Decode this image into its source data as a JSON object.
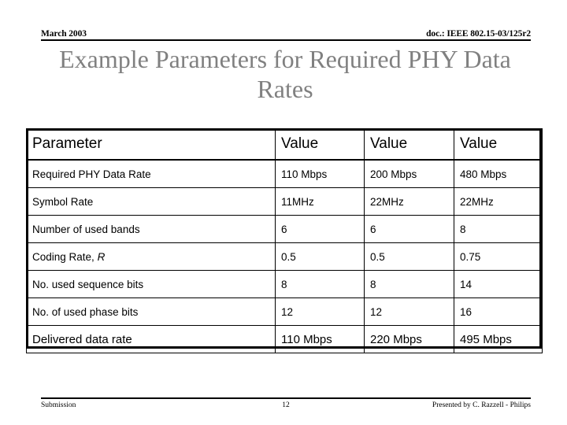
{
  "header": {
    "left": "March 2003",
    "right": "doc.: IEEE 802.15-03/125r2"
  },
  "title": "Example Parameters for Required PHY Data Rates",
  "table": {
    "columns": [
      "Parameter",
      "Value",
      "Value",
      "Value"
    ],
    "rows": [
      {
        "label": "Required PHY Data Rate",
        "label_italic_suffix": "",
        "values": [
          "110 Mbps",
          "200 Mbps",
          "480 Mbps"
        ]
      },
      {
        "label": "Symbol Rate",
        "label_italic_suffix": "",
        "values": [
          "11MHz",
          "22MHz",
          "22MHz"
        ]
      },
      {
        "label": "Number of used bands",
        "label_italic_suffix": "",
        "values": [
          "6",
          "6",
          "8"
        ]
      },
      {
        "label": "Coding Rate, ",
        "label_italic_suffix": "R",
        "values": [
          "0.5",
          "0.5",
          "0.75"
        ]
      },
      {
        "label": "No. used sequence bits",
        "label_italic_suffix": "",
        "values": [
          "8",
          "8",
          "14"
        ]
      },
      {
        "label": "No. of used phase bits",
        "label_italic_suffix": "",
        "values": [
          "12",
          "12",
          "16"
        ]
      },
      {
        "label": "Delivered data rate",
        "label_italic_suffix": "",
        "values": [
          "110 Mbps",
          "220 Mbps",
          "495 Mbps"
        ]
      }
    ]
  },
  "footer": {
    "left": "Submission",
    "page": "12",
    "right": "Presented by C. Razzell - Philips"
  },
  "colors": {
    "title": "#808080",
    "text": "#000000",
    "background": "#ffffff",
    "rule": "#000000"
  }
}
